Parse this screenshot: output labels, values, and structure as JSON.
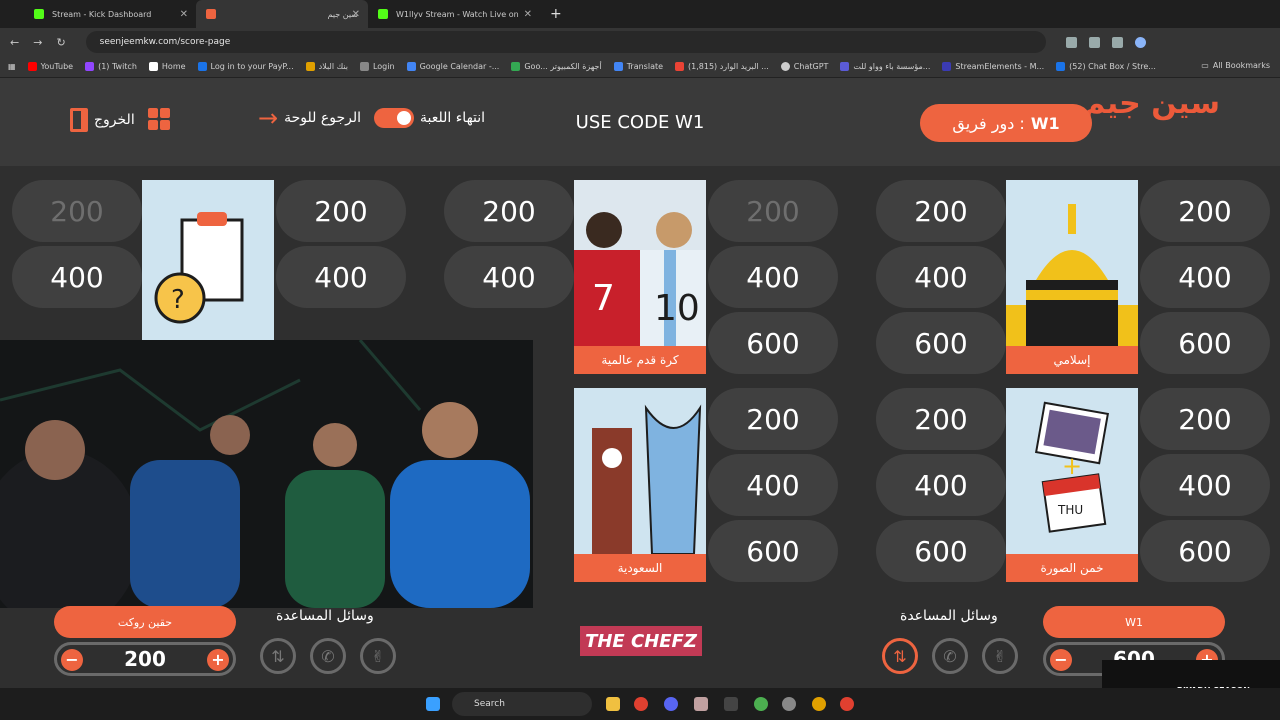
{
  "browser": {
    "tabs": [
      {
        "label": "Stream - Kick Dashboard",
        "color": "#53fc18"
      },
      {
        "label": "سين جيم",
        "color": "#ee6440"
      },
      {
        "label": "W1llyv Stream - Watch Live on",
        "color": "#53fc18"
      }
    ],
    "url": "seenjeemkw.com/score-page",
    "bookmarks": [
      "YouTube",
      "(1) Twitch",
      "Home",
      "Log in to your PayP...",
      "بنك البلاد",
      "Login",
      "Google Calendar -...",
      "Goo... أجهزة الكمبيوتر",
      "Translate",
      "(1,815) البريد الوارد ...",
      "ChatGPT",
      "مؤسسة باء وواو للت...",
      "StreamElements - M...",
      "(52) Chat Box / Stre..."
    ],
    "all_bookmarks": "All Bookmarks"
  },
  "header": {
    "logo": "سين جيم",
    "turn_label": "دور فريق :",
    "turn_team": "W1",
    "code": "USE CODE W1",
    "end_game": "انتهاء اللعبة",
    "back": "الرجوع للوحة",
    "exit": "الخروج"
  },
  "board": {
    "values": [
      "200",
      "400",
      "600"
    ],
    "categories": [
      {
        "name": "إسلامي"
      },
      {
        "name": "كرة قدم عالمية"
      },
      {
        "name": ""
      },
      {
        "name": "خمن الصورة"
      },
      {
        "name": "السعودية"
      }
    ]
  },
  "footer": {
    "left_team": "حقين روكت",
    "left_score": "200",
    "right_team": "W1",
    "right_score": "600",
    "aids_title": "وسائل المساعدة",
    "sponsor": "THE CHEFZ",
    "riyadh": "RIYADH SEASON"
  },
  "taskbar": {
    "search": "Search"
  }
}
